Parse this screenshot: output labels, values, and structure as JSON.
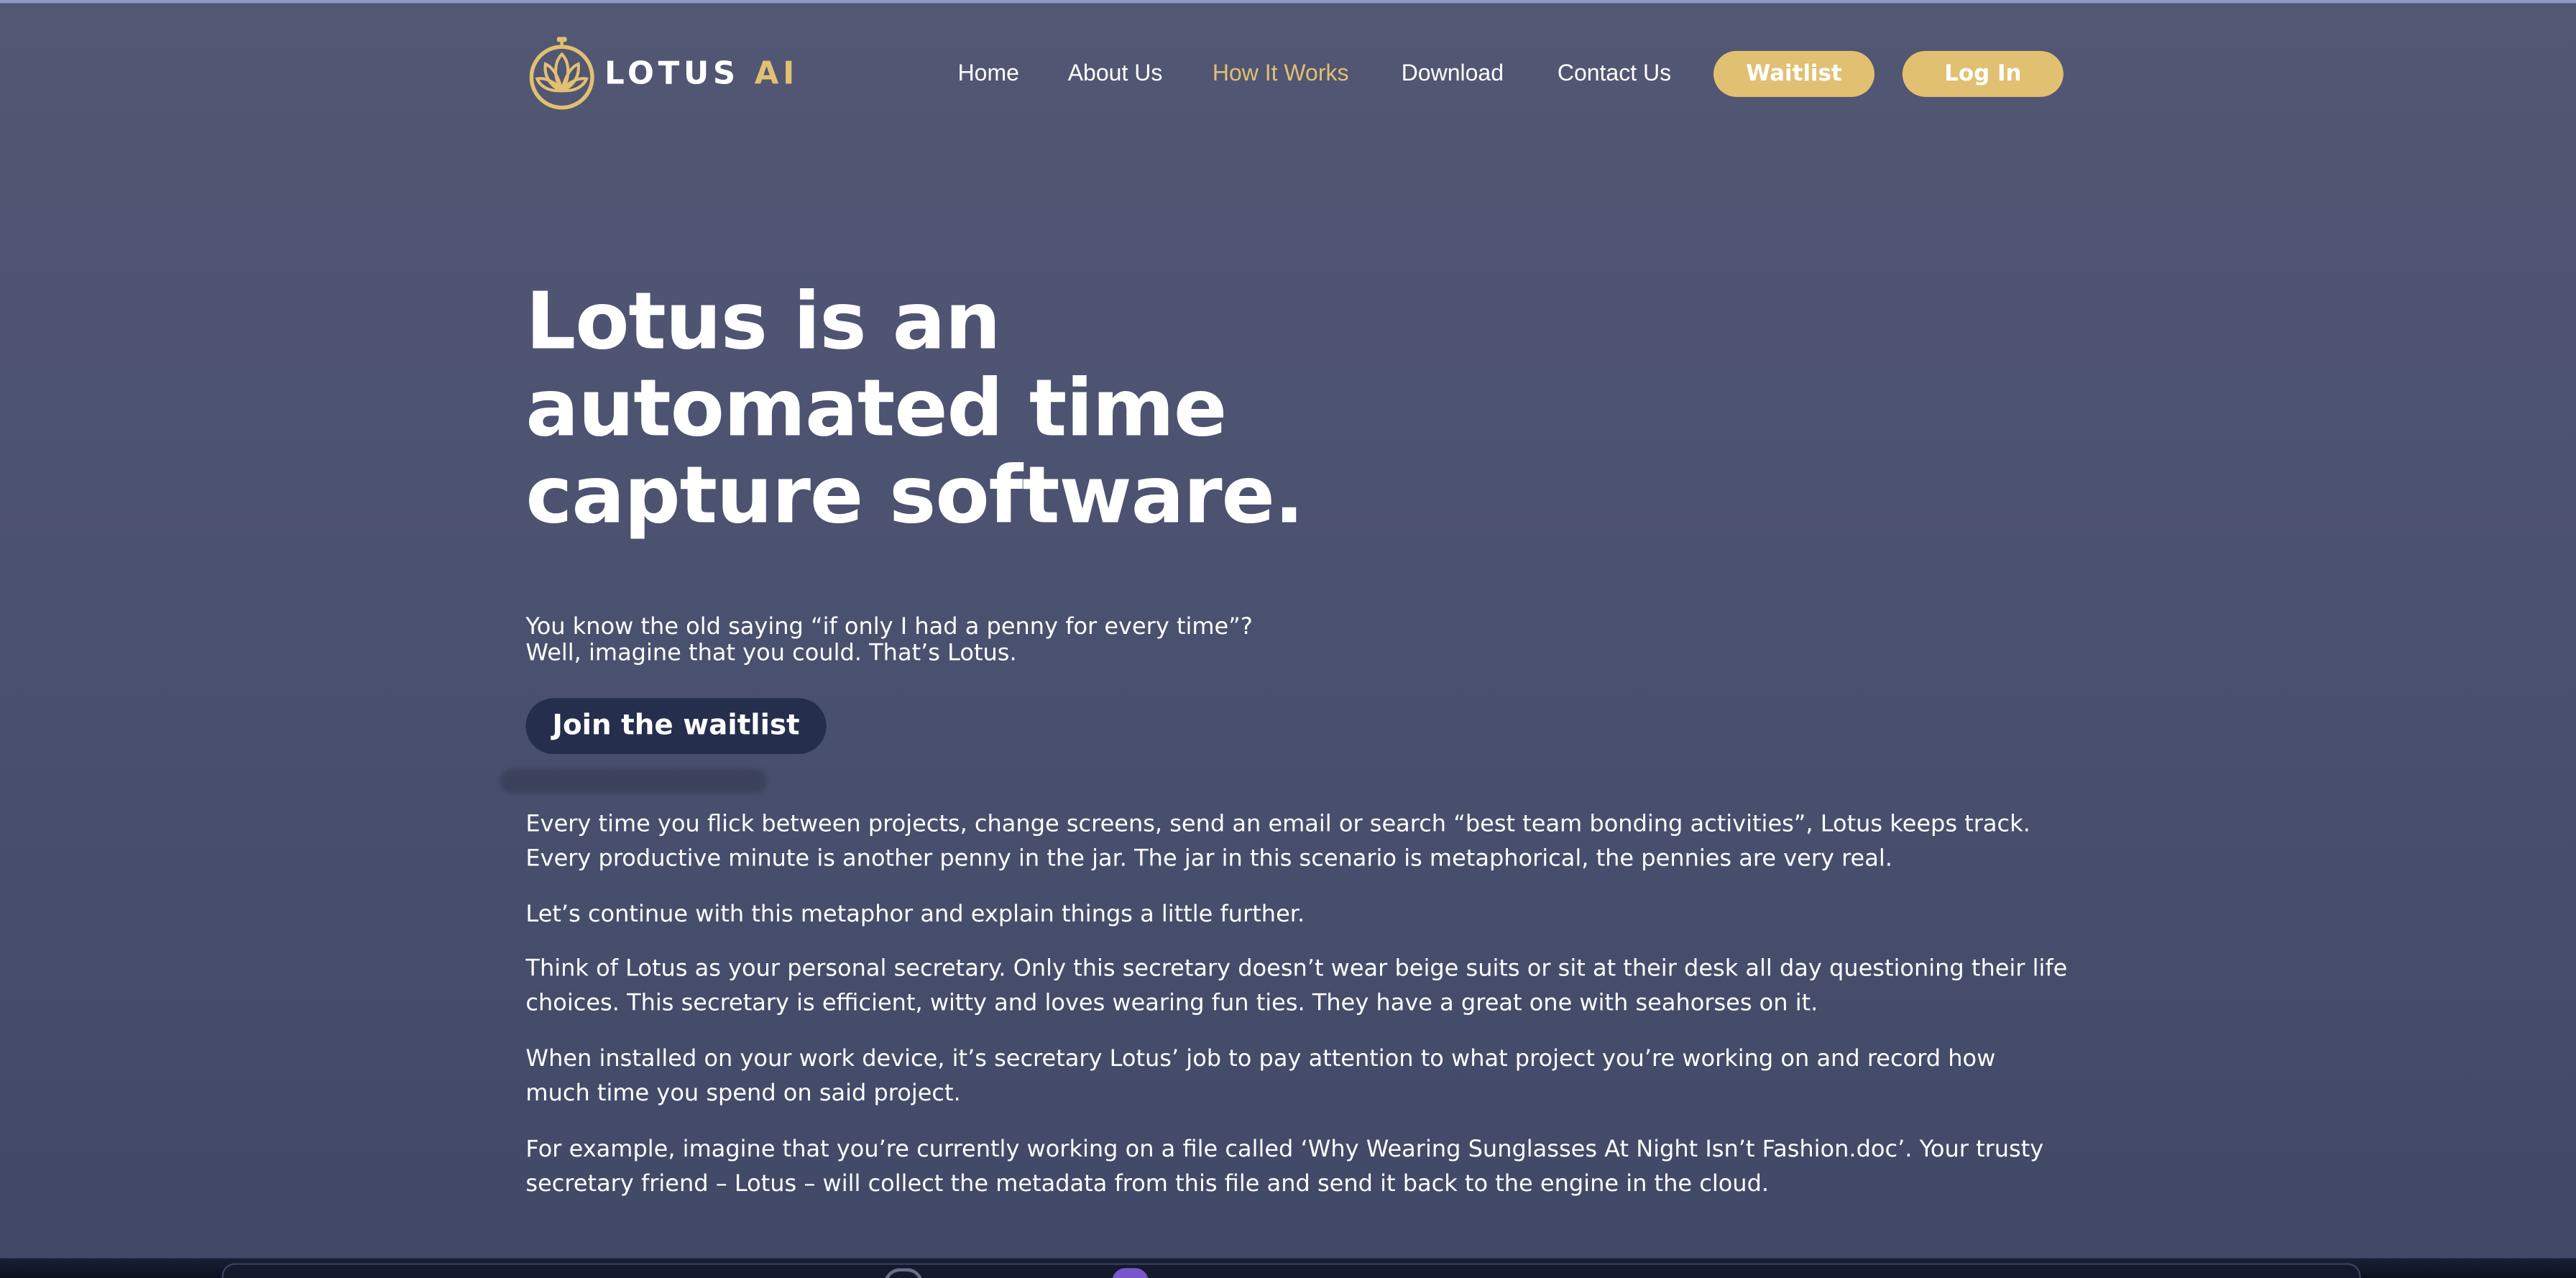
{
  "brand": {
    "name": "LOTUS",
    "suffix": "AI",
    "logo_icon": "lotus-flower-logo"
  },
  "nav": {
    "links": [
      "Home",
      "About Us",
      "How It Works",
      "Download",
      "Contact Us"
    ],
    "active": "How It Works",
    "waitlist_label": "Waitlist",
    "login_label": "Log In"
  },
  "hero": {
    "title_lines": [
      "Lotus is an",
      "automated time",
      "capture software."
    ],
    "intro_lines": [
      "You know the old saying “if only I had a penny for every time”?",
      "Well, imagine that you could. That’s Lotus."
    ],
    "cta_label": "Join the waitlist"
  },
  "body": {
    "paragraphs": [
      [
        "Every time you flick between projects, change screens, send an email or search “best team bonding activities”, Lotus keeps track.",
        "Every productive minute is another penny in the jar. The jar in this scenario is metaphorical, the pennies are very real."
      ],
      [
        "Let’s continue with this metaphor and explain things a little further."
      ],
      [
        "Think of Lotus as your personal secretary. Only this secretary doesn’t wear beige suits or sit at their desk all day questioning their life",
        "choices. This secretary is efficient, witty and loves wearing fun ties. They have a great one with seahorses on it."
      ],
      [
        "When installed on your work device, it’s secretary Lotus’ job to pay attention to what project you’re working on and record how",
        "much time you spend on said project."
      ],
      [
        "For example, imagine that you’re currently working on a file called ‘Why Wearing Sunglasses At Night Isn’t Fashion.doc’. Your trusty",
        "secretary friend – Lotus – will collect the metadata from this file and send it back to the engine in the cloud."
      ]
    ]
  },
  "colors": {
    "accent": "#e1c072",
    "cta_background": "#262e4e",
    "page_background": "#4b5270",
    "text": "#ffffff"
  }
}
